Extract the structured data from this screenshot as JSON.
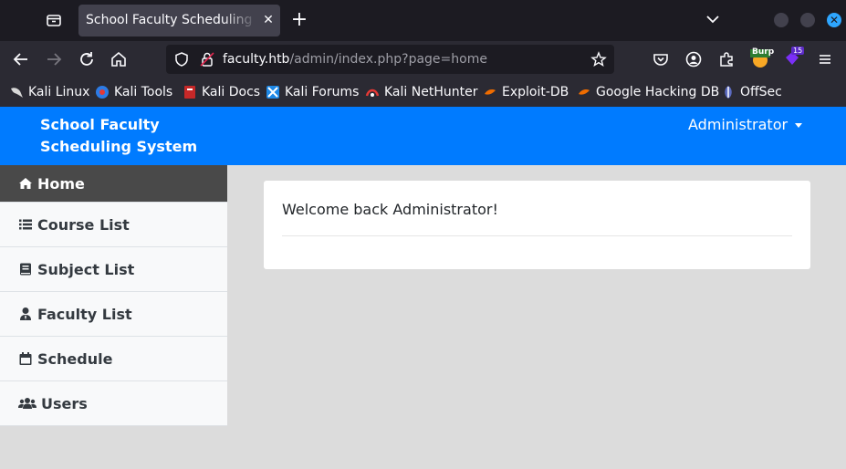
{
  "browser": {
    "tab_title": "School Faculty Scheduling System",
    "url_host": "faculty.htb",
    "url_path": "/admin/index.php?page=home",
    "extension_badge": "15",
    "burp_label": "Burp"
  },
  "bookmarks": [
    {
      "label": "Kali Linux",
      "icon": "kali-dragon-icon"
    },
    {
      "label": "Kali Tools",
      "icon": "kali-tools-icon"
    },
    {
      "label": "Kali Docs",
      "icon": "kali-docs-icon"
    },
    {
      "label": "Kali Forums",
      "icon": "kali-forums-icon"
    },
    {
      "label": "Kali NetHunter",
      "icon": "nethunter-icon"
    },
    {
      "label": "Exploit-DB",
      "icon": "exploit-db-icon"
    },
    {
      "label": "Google Hacking DB",
      "icon": "ghdb-icon"
    },
    {
      "label": "OffSec",
      "icon": "offsec-icon"
    }
  ],
  "app": {
    "brand": "School Faculty Scheduling System",
    "user_menu": "Administrator",
    "accent_color": "#007bff"
  },
  "sidebar": {
    "items": [
      {
        "label": "Home",
        "icon": "home-icon",
        "active": true
      },
      {
        "label": "Course List",
        "icon": "list-icon"
      },
      {
        "label": "Subject List",
        "icon": "book-icon"
      },
      {
        "label": "Faculty List",
        "icon": "user-tie-icon"
      },
      {
        "label": "Schedule",
        "icon": "calendar-icon"
      },
      {
        "label": "Users",
        "icon": "users-icon"
      }
    ]
  },
  "main": {
    "welcome": "Welcome back Administrator!"
  }
}
